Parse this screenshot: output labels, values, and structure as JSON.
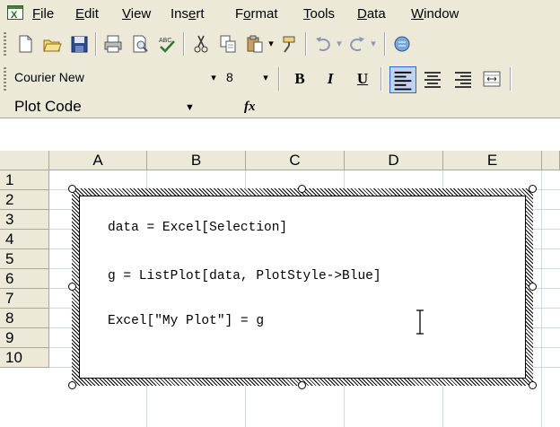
{
  "menu": {
    "items": [
      {
        "label": "File",
        "mnemonic_index": 0
      },
      {
        "label": "Edit",
        "mnemonic_index": 0
      },
      {
        "label": "View",
        "mnemonic_index": 0
      },
      {
        "label": "Insert",
        "mnemonic_index": 3
      },
      {
        "label": "Format",
        "mnemonic_index": 1
      },
      {
        "label": "Tools",
        "mnemonic_index": 0
      },
      {
        "label": "Data",
        "mnemonic_index": 0
      },
      {
        "label": "Window",
        "mnemonic_index": 0
      }
    ]
  },
  "standard_toolbar": {
    "buttons": [
      "new-icon",
      "open-icon",
      "save-icon",
      "print-icon",
      "print-preview-icon",
      "spelling-icon",
      "cut-icon",
      "copy-icon",
      "paste-icon",
      "format-painter-icon",
      "undo-icon",
      "redo-icon",
      "hyperlink-icon"
    ]
  },
  "formatting_toolbar": {
    "font_name": "Courier New",
    "font_size": "8",
    "bold": "B",
    "italic": "I",
    "underline": "U"
  },
  "formula_bar": {
    "name_box": "Plot Code",
    "fx_label": "fx",
    "formula": ""
  },
  "sheet": {
    "columns": [
      "A",
      "B",
      "C",
      "D",
      "E"
    ],
    "rows": [
      "1",
      "2",
      "3",
      "4",
      "5",
      "6",
      "7",
      "8",
      "9",
      "10"
    ]
  },
  "textbox": {
    "line1": "data = Excel[Selection]",
    "line2": "g = ListPlot[data, PlotStyle->Blue]",
    "line3": "Excel[\"My Plot\"] = g"
  },
  "colors": {
    "chrome": "#ece9d8",
    "grid": "#d0d7e5",
    "header_border": "#aca899",
    "active_button": "#c1d2ee"
  }
}
